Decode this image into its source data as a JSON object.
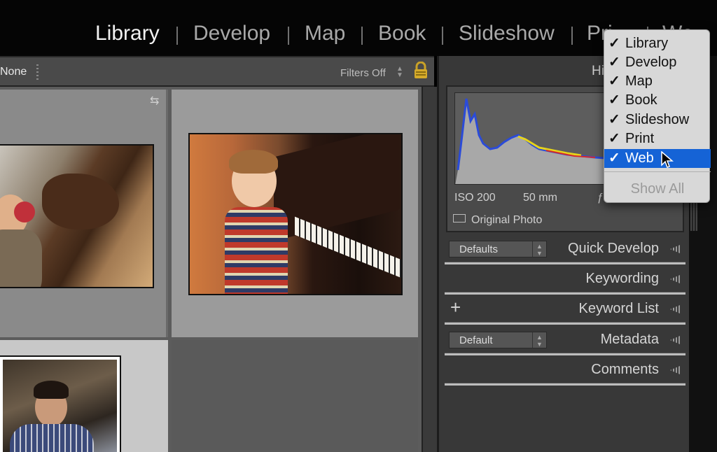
{
  "modules": [
    "Library",
    "Develop",
    "Map",
    "Book",
    "Slideshow",
    "Pri",
    "We"
  ],
  "filterbar": {
    "attribute": "None",
    "filters_label": "Filters Off"
  },
  "histogram": {
    "title": "Hi",
    "iso": "ISO 200",
    "focal": "50 mm",
    "aperture": "ƒ / 1.6",
    "original_photo": "Original Photo"
  },
  "panels": {
    "quick_develop": {
      "title": "Quick Develop",
      "preset": "Defaults"
    },
    "keywording": {
      "title": "Keywording"
    },
    "keyword_list": {
      "title": "Keyword List",
      "add": "+"
    },
    "metadata": {
      "title": "Metadata",
      "preset": "Default"
    },
    "comments": {
      "title": "Comments"
    }
  },
  "menu": {
    "items": [
      "Library",
      "Develop",
      "Map",
      "Book",
      "Slideshow",
      "Print",
      "Web"
    ],
    "checkmark": "✓",
    "selected": "Web",
    "show_all": "Show All"
  },
  "icons": [
    "lock-icon",
    "rotate-icon",
    "cursor-icon",
    "panel-collapse-icon"
  ],
  "colors": {
    "menu_highlight": "#1563d6",
    "active_module": "#f2f2f2"
  }
}
